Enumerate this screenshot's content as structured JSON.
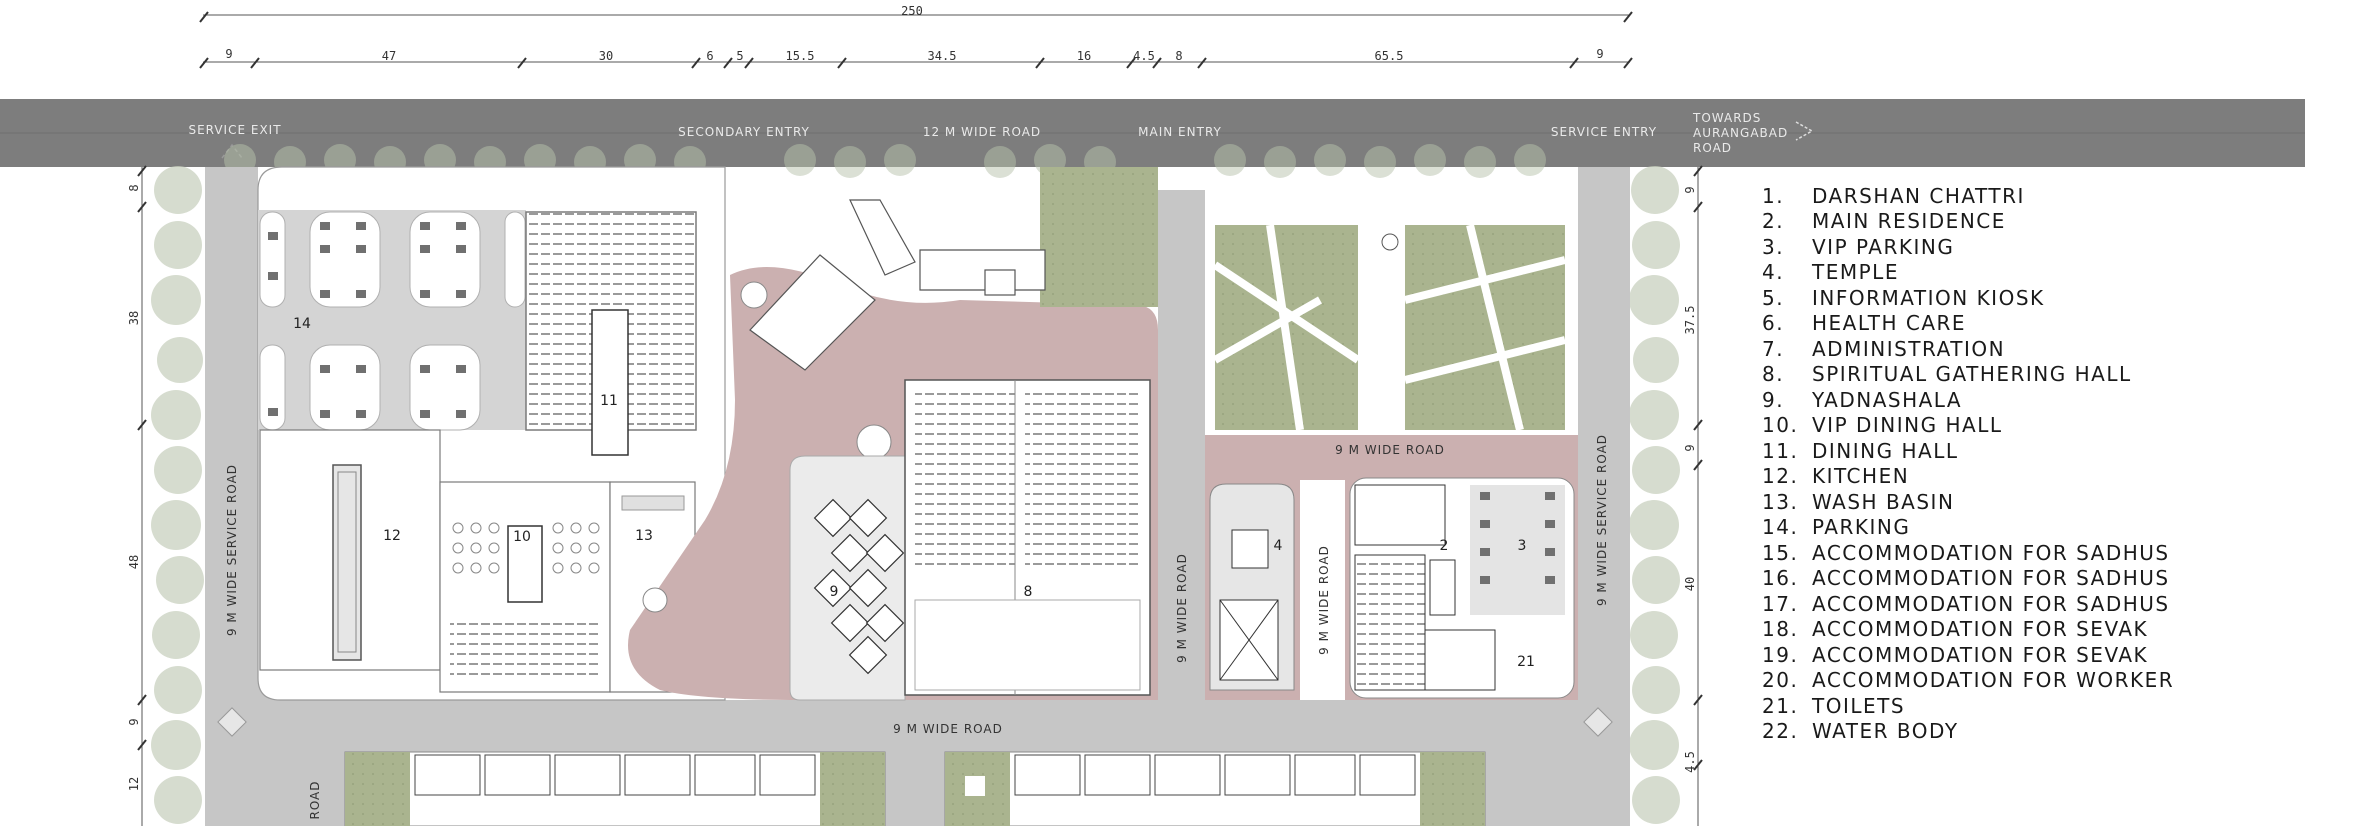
{
  "dimensions_top": {
    "overall": "250",
    "segments": [
      "9",
      "47",
      "30",
      "6",
      "5",
      "15.5",
      "34.5",
      "16",
      "4.5",
      "8",
      "65.5",
      "9"
    ]
  },
  "dimensions_left": [
    "8",
    "38",
    "48",
    "9",
    "12"
  ],
  "dimensions_right": [
    "9",
    "37.5",
    "9",
    "40",
    "4.5"
  ],
  "entries": {
    "service_exit": "SERVICE EXIT",
    "secondary_entry": "SECONDARY ENTRY",
    "top_road": "12 M WIDE ROAD",
    "main_entry": "MAIN ENTRY",
    "service_entry": "SERVICE ENTRY",
    "towards": [
      "TOWARDS",
      "AURANGABAD",
      "ROAD"
    ]
  },
  "roads": {
    "left_service": "9 M WIDE SERVICE ROAD",
    "right_service": "9 M WIDE SERVICE ROAD",
    "bottom": "9 M WIDE ROAD",
    "east_internal": "9 M WIDE ROAD",
    "vertical_a": "9 M WIDE ROAD",
    "vertical_b": "9 M WIDE ROAD",
    "bottom_left": "ROAD"
  },
  "zone_numbers": {
    "parking": "14",
    "dining": "11",
    "kitchen": "12",
    "vip_dining": "10",
    "wash_basin": "13",
    "yadnashala": "9",
    "gathering_hall": "8",
    "temple": "4",
    "main_residence": "2",
    "vip_parking": "3",
    "toilets": "21"
  },
  "legend": [
    {
      "num": "1.",
      "label": "DARSHAN CHATTRI"
    },
    {
      "num": "2.",
      "label": "MAIN RESIDENCE"
    },
    {
      "num": "3.",
      "label": "VIP PARKING"
    },
    {
      "num": "4.",
      "label": "TEMPLE"
    },
    {
      "num": "5.",
      "label": "INFORMATION KIOSK"
    },
    {
      "num": "6.",
      "label": "HEALTH CARE"
    },
    {
      "num": "7.",
      "label": "ADMINISTRATION"
    },
    {
      "num": "8.",
      "label": "SPIRITUAL GATHERING HALL"
    },
    {
      "num": "9.",
      "label": "YADNASHALA"
    },
    {
      "num": "10.",
      "label": "VIP DINING HALL"
    },
    {
      "num": "11.",
      "label": "DINING HALL"
    },
    {
      "num": "12.",
      "label": "KITCHEN"
    },
    {
      "num": "13.",
      "label": "WASH BASIN"
    },
    {
      "num": "14.",
      "label": "PARKING"
    },
    {
      "num": "15.",
      "label": "ACCOMMODATION FOR SADHUS"
    },
    {
      "num": "16.",
      "label": "ACCOMMODATION FOR SADHUS"
    },
    {
      "num": "17.",
      "label": "ACCOMMODATION FOR SADHUS"
    },
    {
      "num": "18.",
      "label": "ACCOMMODATION FOR SEVAK"
    },
    {
      "num": "19.",
      "label": "ACCOMMODATION FOR SEVAK"
    },
    {
      "num": "20.",
      "label": "ACCOMMODATION FOR WORKER"
    },
    {
      "num": "21.",
      "label": "TOILETS"
    },
    {
      "num": "22.",
      "label": "WATER BODY"
    }
  ],
  "colors": {
    "road_band": "#7d7d7d",
    "site_road": "#c6c6c6",
    "plaza": "#cbb0b0",
    "lawn": "#a8b28f",
    "tree": "#c9d1bf"
  }
}
